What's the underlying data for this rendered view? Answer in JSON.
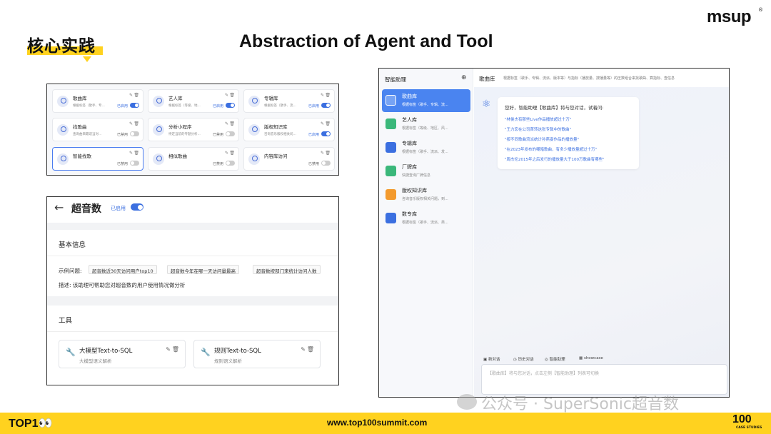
{
  "header": {
    "section_label": "核心实践",
    "title": "Abstraction of Agent and Tool",
    "brand": "msup"
  },
  "agent_grid": {
    "cards": [
      {
        "name": "歌曲库",
        "desc": "根据标签（歌手、专...",
        "status": "已启用",
        "enabled": true
      },
      {
        "name": "艺人库",
        "desc": "根据标签（等级、地...",
        "status": "已启用",
        "enabled": true
      },
      {
        "name": "专辑库",
        "desc": "根据标签（歌手、流...",
        "status": "已启用",
        "enabled": true
      },
      {
        "name": "找歌曲",
        "desc": "查询曲目最适当对...",
        "status": "已禁用",
        "enabled": false
      },
      {
        "name": "分析小程序",
        "desc": "待定当前的专题分析...",
        "status": "已禁用",
        "enabled": false
      },
      {
        "name": "版权知识库",
        "desc": "咨询音乐版权相关问...",
        "status": "已启用",
        "enabled": true
      },
      {
        "name": "智能找歌",
        "desc": "",
        "status": "已禁用",
        "enabled": false
      },
      {
        "name": "相似歌曲",
        "desc": "",
        "status": "已禁用",
        "enabled": false
      },
      {
        "name": "内容库访问",
        "desc": "",
        "status": "已禁用",
        "enabled": false
      }
    ]
  },
  "detail": {
    "back": "←",
    "title": "超音数",
    "status": "已启用",
    "basic_title": "基本信息",
    "example_label": "示例问题:",
    "examples": [
      "超音数近30天访问用户top10",
      "超音数今年在哪一天访问量最高",
      "超音数按部门来统计访问人数"
    ],
    "desc_label": "描述:",
    "desc": "该助理可帮助您对超音数的用户使用情况做分析",
    "tools_title": "工具",
    "tools": [
      {
        "name": "大模型Text-to-SQL",
        "desc": "大模型语义解析"
      },
      {
        "name": "规则Text-to-SQL",
        "desc": "规则语义解析"
      }
    ]
  },
  "chat": {
    "sidebar_title": "智能助理",
    "plus": "⊕",
    "items": [
      {
        "name": "歌曲库",
        "desc": "根据标签（歌手、专辑、流...",
        "color": "#ffffff"
      },
      {
        "name": "艺人库",
        "desc": "根据标签（等级、地区、风...",
        "color": "#3ab77a"
      },
      {
        "name": "专辑库",
        "desc": "根据标签（歌手、流派、发...",
        "color": "#3b6fe0"
      },
      {
        "name": "厂牌库",
        "desc": "快捷查询厂牌信息",
        "color": "#3ab77a"
      },
      {
        "name": "版权知识库",
        "desc": "咨询音乐版权相关问题，到...",
        "color": "#f39a2e"
      },
      {
        "name": "数专库",
        "desc": "根据标签（歌手、流派、类...",
        "color": "#3b6fe0"
      }
    ],
    "topbar_title": "歌曲库",
    "topbar_desc": "根据标签（歌手、专辑、流派、版本等）与指标（播放量、搜播量等）的圧数组合来找歌曲、算指标、查信息",
    "greeting": "您好，智能助理【歌曲库】将与您对话，试着问:",
    "questions": [
      "\"林俊杰有那些Live作品播放超过十万\"",
      "\"王力宏在公司首转这张专辑中的歌曲\"",
      "\"按不同歌曲流派统计孙燕姿作品的播放量\"",
      "\"在2023年发布的嘲暗歌曲，有多少播放量超过十万\"",
      "\"周杰伦2015年之后发行的播放量大于100万歌曲有哪些\""
    ],
    "toolbar": [
      "新对话",
      "历史对话",
      "智能助理",
      "showcase"
    ],
    "input_placeholder": "【歌曲库】将与您对话，点击左侧【智能助理】列表可切换"
  },
  "watermark": "公众号 · SuperSonic超音数",
  "footer": {
    "left": "TOP1👀",
    "url": "www.top100summit.com",
    "right": "100",
    "right_sub": "CASE STUDIES"
  },
  "colors": {
    "accent": "#ffd21f",
    "primary": "#3b6fe0"
  }
}
